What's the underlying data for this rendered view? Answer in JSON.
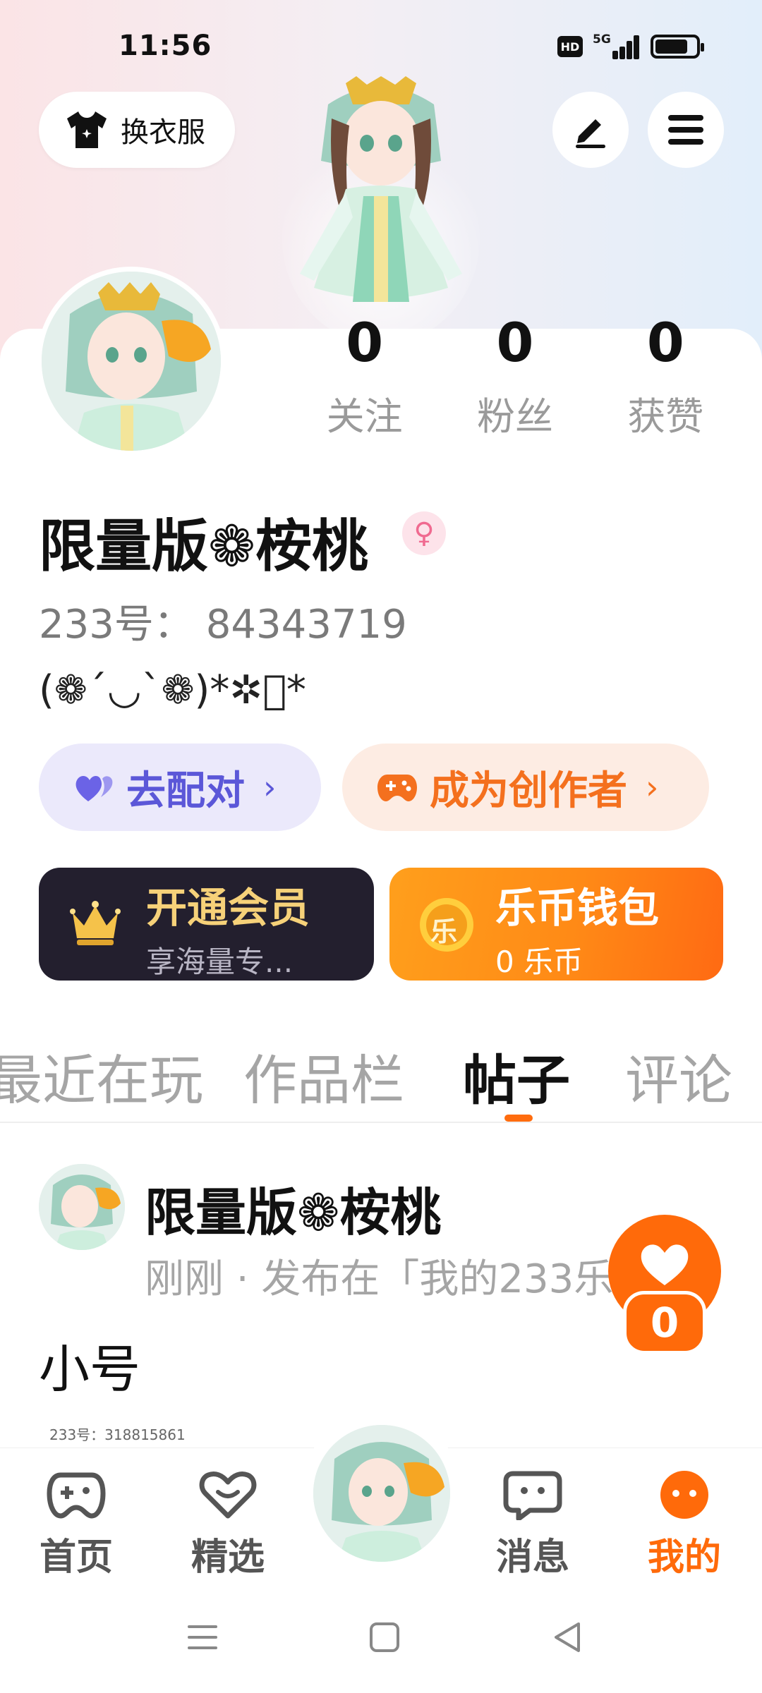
{
  "status_bar": {
    "time": "11:56",
    "hd_label": "HD",
    "network_label": "5G",
    "signal_bars": 4,
    "battery_level": 0.8
  },
  "header": {
    "outfit_button_label": "换衣服",
    "outfit_icon": "tshirt-icon",
    "edit_icon": "pen-icon",
    "menu_icon": "hamburger-menu-icon"
  },
  "profile": {
    "stats": [
      {
        "value": "0",
        "label": "关注"
      },
      {
        "value": "0",
        "label": "粉丝"
      },
      {
        "value": "0",
        "label": "获赞"
      }
    ],
    "username": "限量版❁桉桃",
    "gender_icon": "♀",
    "user_id": "233号： 84343719",
    "bio": "(❁´◡`❁)*✲ﾟ*"
  },
  "actions": {
    "match_label": "去配对",
    "match_chevron": "›",
    "creator_label": "成为创作者",
    "creator_chevron": "›",
    "vip_title": "开通会员",
    "vip_sub": "享海量专...",
    "wallet_title": "乐币钱包",
    "wallet_sub": "0 乐币",
    "wallet_coin_char": "乐"
  },
  "tabs": [
    {
      "label": "最近在玩",
      "active": false
    },
    {
      "label": "作品栏",
      "active": false
    },
    {
      "label": "帖子",
      "active": true
    },
    {
      "label": "评论",
      "active": false
    }
  ],
  "post": {
    "author": "限量版❁桉桃",
    "meta": "刚刚 · 发布在「我的233乐园」",
    "text": "小号",
    "image_caption": "233号：318815861",
    "like_count": "0"
  },
  "bottom_nav": [
    {
      "label": "首页",
      "icon": "gamepad-icon",
      "active": false
    },
    {
      "label": "精选",
      "icon": "heart-chat-icon",
      "active": false
    },
    {
      "label": "消息",
      "icon": "chat-bubble-icon",
      "active": false
    },
    {
      "label": "我的",
      "icon": "smiley-dots-icon",
      "active": true
    }
  ],
  "colors": {
    "accent": "#ff6a0a",
    "match": "#5b57d8",
    "creator": "#f4701e",
    "vip_bg": "#231f2e",
    "vip_gold": "#f6d179"
  }
}
